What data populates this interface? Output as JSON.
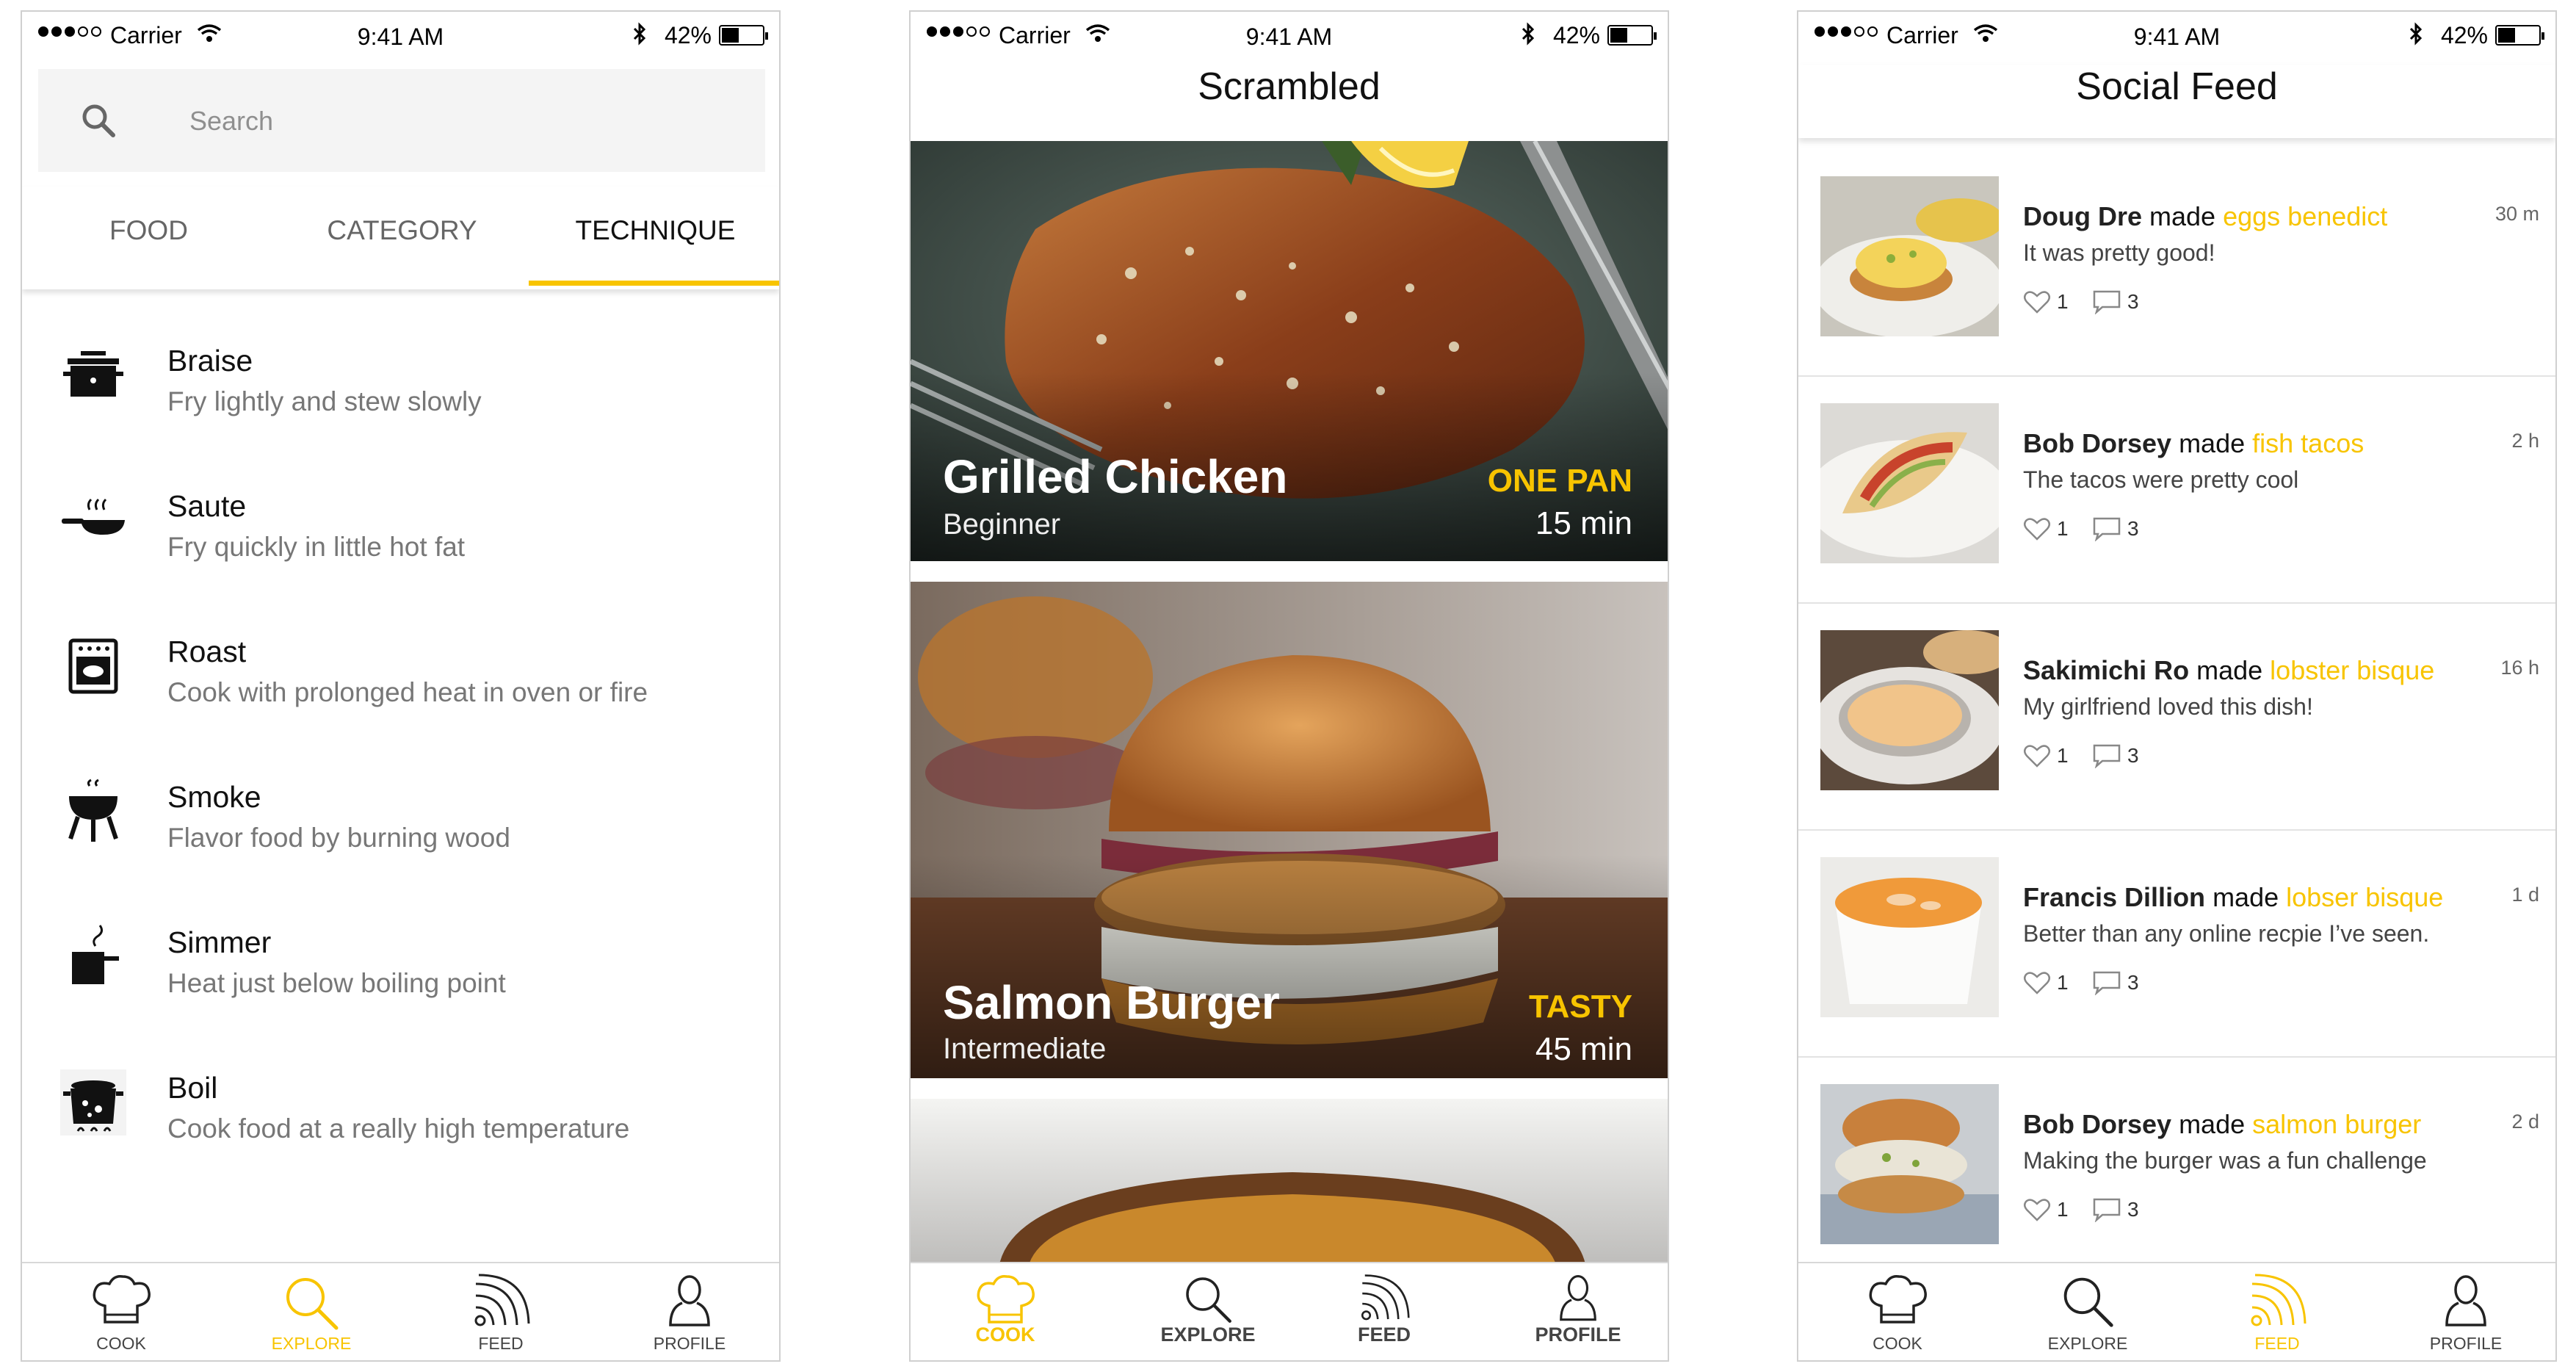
{
  "status_bar": {
    "carrier": "Carrier",
    "time": "9:41 AM",
    "battery": "42%",
    "battery_level": 0.42
  },
  "explore": {
    "search_placeholder": "Search",
    "tabs": [
      "FOOD",
      "CATEGORY",
      "TECHNIQUE"
    ],
    "active_tab": "TECHNIQUE",
    "techniques": [
      {
        "name": "Braise",
        "description": "Fry lightly and stew slowly",
        "icon": "braise-pot-icon"
      },
      {
        "name": "Saute",
        "description": "Fry quickly in little hot fat",
        "icon": "saute-pan-icon"
      },
      {
        "name": "Roast",
        "description": "Cook with prolonged heat in oven or fire",
        "icon": "oven-icon"
      },
      {
        "name": "Smoke",
        "description": "Flavor food by burning wood",
        "icon": "grill-icon"
      },
      {
        "name": "Simmer",
        "description": "Heat just below boiling point",
        "icon": "simmer-pot-icon"
      },
      {
        "name": "Boil",
        "description": "Cook food at a really high temperature",
        "icon": "boil-pot-icon"
      }
    ],
    "tabbar": [
      "COOK",
      "EXPLORE",
      "FEED",
      "PROFILE"
    ],
    "active": "EXPLORE"
  },
  "cook": {
    "title": "Scrambled",
    "recipes": [
      {
        "name": "Grilled Chicken",
        "level": "Beginner",
        "tag": "ONE PAN",
        "time": "15 min"
      },
      {
        "name": "Salmon Burger",
        "level": "Intermediate",
        "tag": "TASTY",
        "time": "45 min"
      }
    ],
    "tabbar": [
      "COOK",
      "EXPLORE",
      "FEED",
      "PROFILE"
    ],
    "active": "COOK"
  },
  "feed": {
    "title": "Social Feed",
    "verb": "made",
    "posts": [
      {
        "user": "Doug Dre",
        "dish": "eggs benedict",
        "time": "30 m",
        "comment": "It was pretty good!",
        "likes": "1",
        "comments": "3"
      },
      {
        "user": "Bob Dorsey",
        "dish": "fish tacos",
        "time": "2 h",
        "comment": "The tacos were pretty cool",
        "likes": "1",
        "comments": "3"
      },
      {
        "user": "Sakimichi Ro",
        "dish": "lobster bisque",
        "time": "16 h",
        "comment": "My girlfriend loved this dish!",
        "likes": "1",
        "comments": "3"
      },
      {
        "user": "Francis Dillion",
        "dish": "lobser bisque",
        "time": "1 d",
        "comment": "Better than any online recpie I’ve seen.",
        "likes": "1",
        "comments": "3"
      },
      {
        "user": "Bob Dorsey",
        "dish": "salmon burger",
        "time": "2 d",
        "comment": "Making the burger was a fun challenge",
        "likes": "1",
        "comments": "3"
      }
    ],
    "tabbar": [
      "COOK",
      "EXPLORE",
      "FEED",
      "PROFILE"
    ],
    "active": "FEED"
  },
  "colors": {
    "accent": "#f8c400",
    "text": "#111111",
    "muted": "#777777"
  }
}
